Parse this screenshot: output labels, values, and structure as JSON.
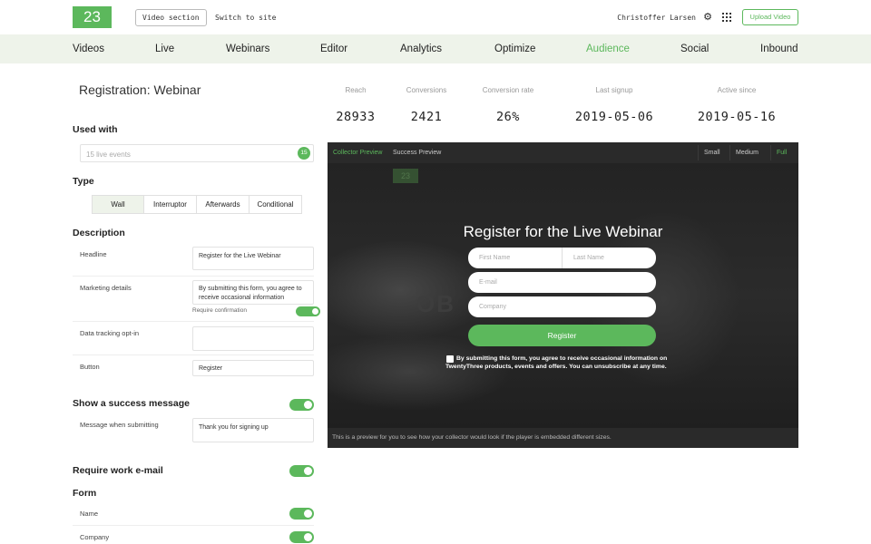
{
  "header": {
    "logo_text": "23",
    "video_section": "Video section",
    "switch_to_site": "Switch to site",
    "user_name": "Christoffer Larsen",
    "upload_label": "Upload Video",
    "accent": "#5cb85c"
  },
  "nav": {
    "items": [
      {
        "label": "Videos"
      },
      {
        "label": "Live"
      },
      {
        "label": "Webinars"
      },
      {
        "label": "Editor"
      },
      {
        "label": "Analytics"
      },
      {
        "label": "Optimize"
      },
      {
        "label": "Audience",
        "active": true
      },
      {
        "label": "Social"
      },
      {
        "label": "Inbound"
      }
    ]
  },
  "page": {
    "title": "Registration: Webinar"
  },
  "stats": [
    {
      "label": "Reach",
      "value": "28933"
    },
    {
      "label": "Conversions",
      "value": "2421"
    },
    {
      "label": "Conversion rate",
      "value": "26%"
    },
    {
      "label": "Last signup",
      "value": "2019-05-06"
    },
    {
      "label": "Active since",
      "value": "2019-05-16"
    }
  ],
  "used_with": {
    "title": "Used with",
    "placeholder": "15 live events",
    "count": "15"
  },
  "type": {
    "title": "Type",
    "options": [
      "Wall",
      "Interruptor",
      "Afterwards",
      "Conditional"
    ],
    "selected": "Wall"
  },
  "description": {
    "title": "Description",
    "headline_label": "Headline",
    "headline_value": "Register for the Live Webinar",
    "marketing_label": "Marketing details",
    "marketing_value": "By submitting this form, you agree to receive occasional information",
    "require_confirmation": "Require confirmation",
    "tracking_label": "Data tracking opt-in",
    "tracking_value": "",
    "button_label": "Button",
    "button_value": "Register"
  },
  "success": {
    "title": "Show a success message",
    "message_label": "Message when submitting",
    "message_value": "Thank you for signing up"
  },
  "work_email": {
    "title": "Require work e-mail"
  },
  "form": {
    "title": "Form",
    "fields": [
      "Name",
      "Company"
    ]
  },
  "preview": {
    "tabs": [
      "Collector Preview",
      "Success Preview"
    ],
    "sizes": [
      "Small",
      "Medium",
      "Full"
    ],
    "active_size": "Full",
    "ghost_logo": "23",
    "ghost_text": "OB",
    "headline": "Register for the Live Webinar",
    "first_name": "First Name",
    "last_name": "Last Name",
    "email": "E-mail",
    "company": "Company",
    "button": "Register",
    "consent": "By submitting this form, you agree to receive occasional information on TwentyThree products, events and offers. You can unsubscribe at any time.",
    "footer": "This is a preview for you to see how your collector would look if the player is embedded different sizes."
  }
}
